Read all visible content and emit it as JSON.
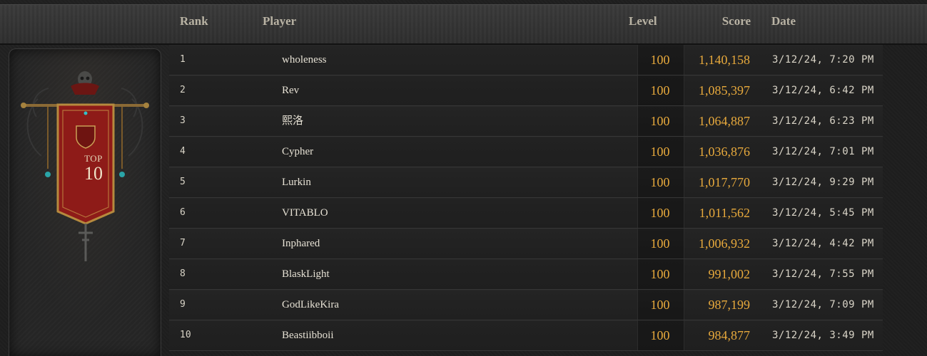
{
  "header": {
    "rank": "Rank",
    "player": "Player",
    "level": "Level",
    "score": "Score",
    "date": "Date"
  },
  "banner": {
    "top_label": "TOP",
    "number": "10"
  },
  "rows": [
    {
      "rank": "1",
      "player": "wholeness",
      "level": "100",
      "score": "1,140,158",
      "date": "3/12/24, 7:20 PM"
    },
    {
      "rank": "2",
      "player": "Rev",
      "level": "100",
      "score": "1,085,397",
      "date": "3/12/24, 6:42 PM"
    },
    {
      "rank": "3",
      "player": "熙洛",
      "level": "100",
      "score": "1,064,887",
      "date": "3/12/24, 6:23 PM"
    },
    {
      "rank": "4",
      "player": "Cypher",
      "level": "100",
      "score": "1,036,876",
      "date": "3/12/24, 7:01 PM"
    },
    {
      "rank": "5",
      "player": "Lurkin",
      "level": "100",
      "score": "1,017,770",
      "date": "3/12/24, 9:29 PM"
    },
    {
      "rank": "6",
      "player": "VITABLO",
      "level": "100",
      "score": "1,011,562",
      "date": "3/12/24, 5:45 PM"
    },
    {
      "rank": "7",
      "player": "Inphared",
      "level": "100",
      "score": "1,006,932",
      "date": "3/12/24, 4:42 PM"
    },
    {
      "rank": "8",
      "player": "BlaskLight",
      "level": "100",
      "score": "991,002",
      "date": "3/12/24, 7:55 PM"
    },
    {
      "rank": "9",
      "player": "GodLikeKira",
      "level": "100",
      "score": "987,199",
      "date": "3/12/24, 7:09 PM"
    },
    {
      "rank": "10",
      "player": "Beastiibboii",
      "level": "100",
      "score": "984,877",
      "date": "3/12/24, 3:49 PM"
    }
  ],
  "colors": {
    "accent_gold": "#e7a93c",
    "banner_red": "#8e1b18"
  }
}
